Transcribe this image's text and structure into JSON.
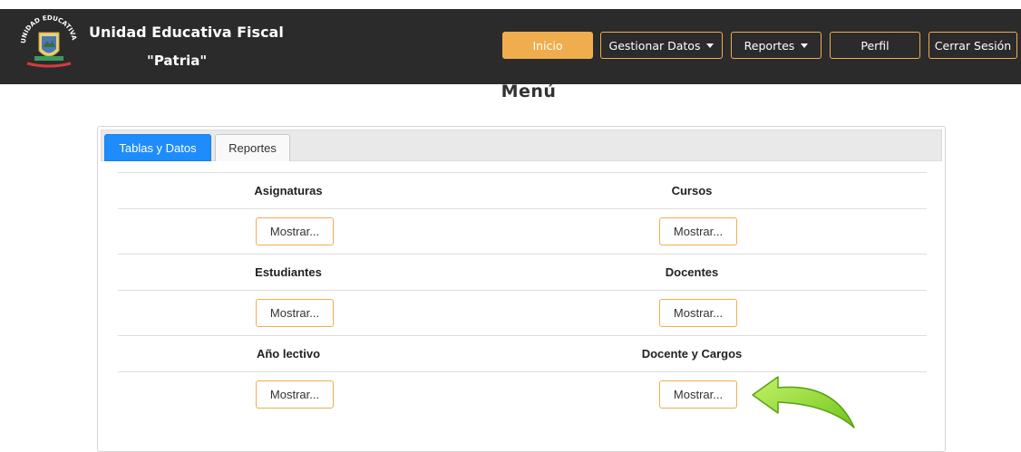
{
  "header": {
    "brand_line1": "Unidad Educativa Fiscal",
    "brand_line2": "\"Patria\"",
    "nav": {
      "inicio": "Inicio",
      "gestionar": "Gestionar Datos",
      "reportes": "Reportes",
      "perfil": "Perfil",
      "cerrar": "Cerrar Sesión"
    }
  },
  "page_title": "Menú",
  "tabs": {
    "active": "Tablas y Datos",
    "inactive": "Reportes"
  },
  "items": {
    "asignaturas": "Asignaturas",
    "cursos": "Cursos",
    "estudiantes": "Estudiantes",
    "docentes": "Docentes",
    "anio_lectivo": "Año lectivo",
    "docente_cargos": "Docente y Cargos"
  },
  "button_label": "Mostrar...",
  "colors": {
    "navbar": "#2b2b2b",
    "accent": "#f0ad4e",
    "tab_active": "#1e8cfb",
    "arrow": "#7ed321"
  }
}
